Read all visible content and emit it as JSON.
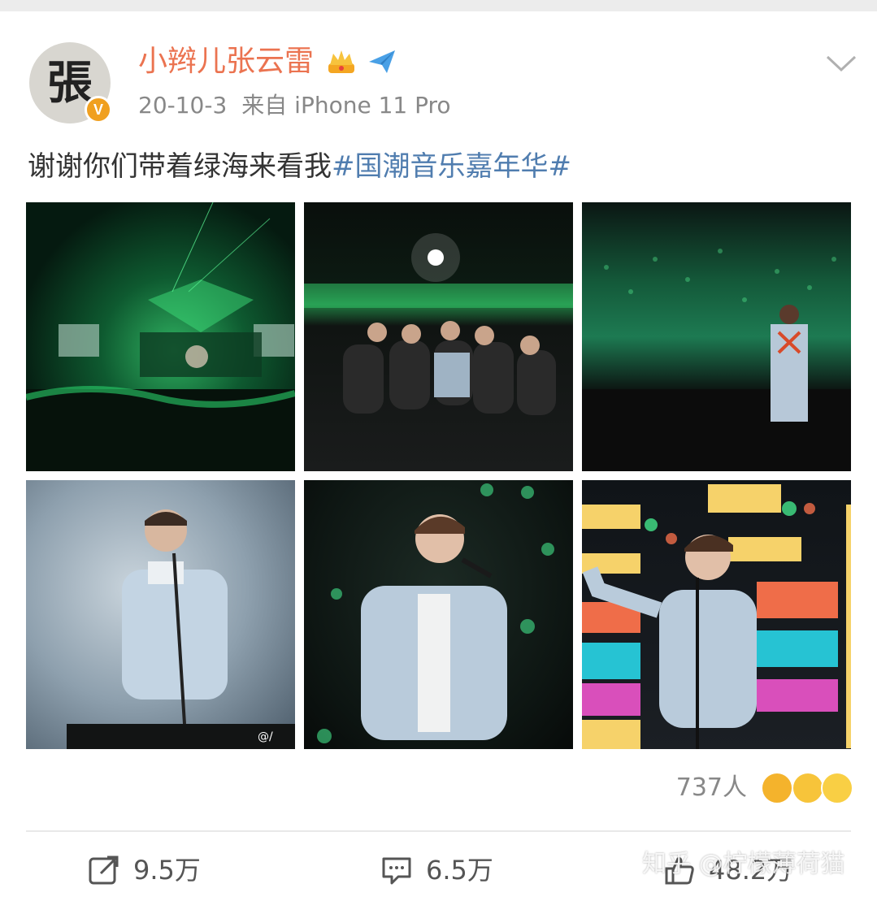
{
  "post": {
    "username": "小辫儿张云雷",
    "date": "20-10-3",
    "source": "来自 iPhone 11 Pro",
    "text_plain": "谢谢你们带着绿海来看我",
    "text_tag": "#国潮音乐嘉年华#"
  },
  "avatar": {
    "glyph": "張",
    "badge": "V"
  },
  "photos": [
    {
      "alt": "concert-stage-green-lights"
    },
    {
      "alt": "group-photo-on-stage"
    },
    {
      "alt": "singer-facing-crowd"
    },
    {
      "alt": "singer-smoke-stage"
    },
    {
      "alt": "singer-denim-jacket"
    },
    {
      "alt": "singer-colorful-screen"
    }
  ],
  "photo_watermark": "@/",
  "reactions": {
    "count": "737人"
  },
  "actions": {
    "repost_count": "9.5万",
    "comment_count": "6.5万",
    "like_count": "48.2万"
  },
  "watermark": "知乎 @柠檬薄荷猫",
  "colors": {
    "username": "#eb7350",
    "hashtag": "#507daf",
    "meta": "#888888"
  },
  "icons": [
    "crown-icon",
    "send-plane-icon",
    "chevron-down-icon",
    "repost-icon",
    "comment-icon",
    "like-icon",
    "verified-badge-icon"
  ]
}
